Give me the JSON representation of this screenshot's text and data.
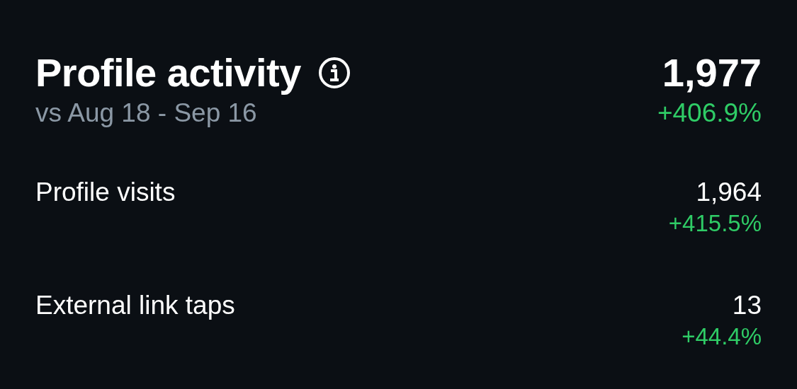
{
  "header": {
    "title": "Profile activity",
    "subtitle": "vs Aug 18 - Sep 16",
    "total": "1,977",
    "change": "+406.9%"
  },
  "metrics": [
    {
      "label": "Profile visits",
      "value": "1,964",
      "change": "+415.5%"
    },
    {
      "label": "External link taps",
      "value": "13",
      "change": "+44.4%"
    }
  ]
}
